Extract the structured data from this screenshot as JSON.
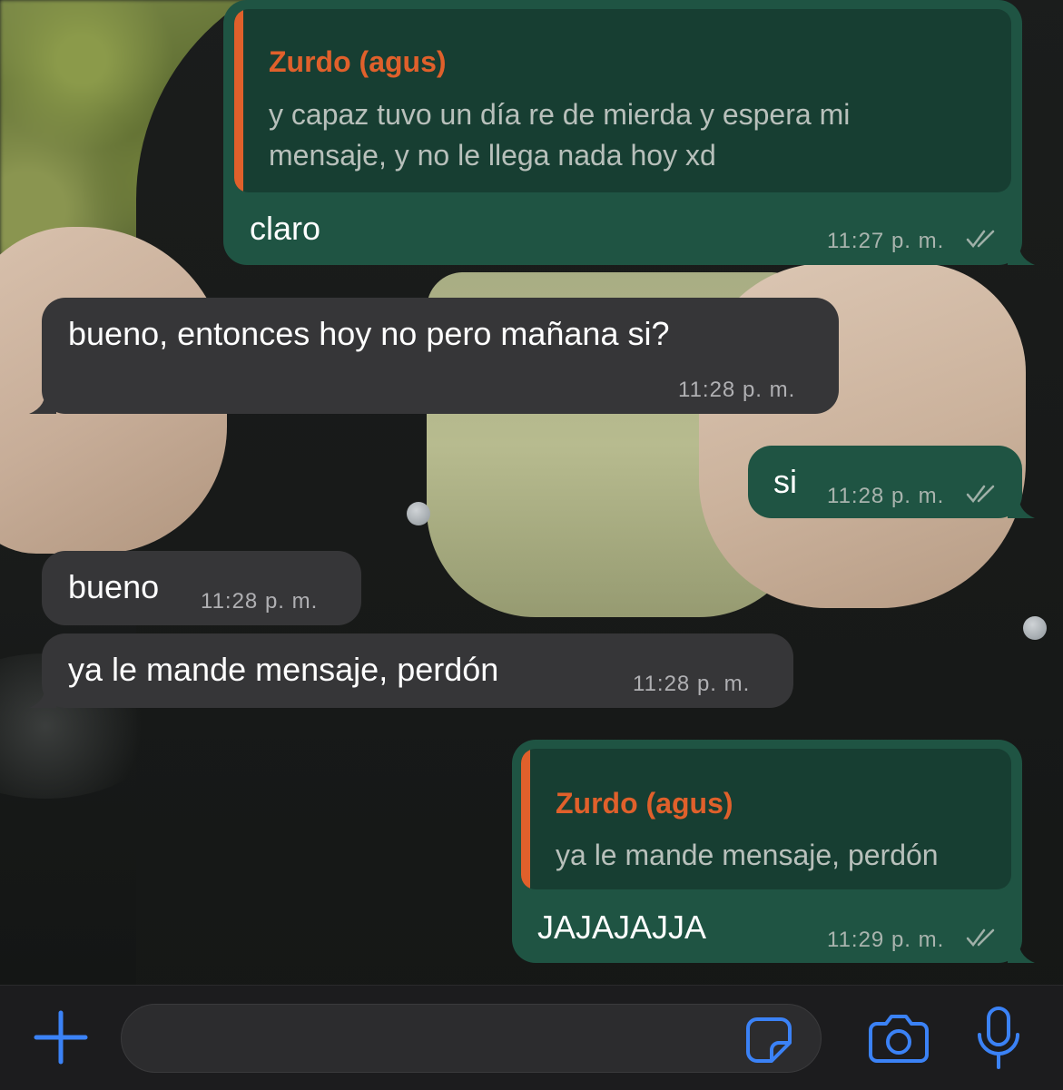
{
  "app": {
    "accent_color": "#3b82f6",
    "outgoing_bubble_color": "#1f5443",
    "incoming_bubble_color": "#363638",
    "quote_author_color": "#e0602b"
  },
  "messages": [
    {
      "direction": "outgoing",
      "quote": {
        "author": "Zurdo (agus)",
        "line1": "y capaz tuvo un día re de mierda y espera mi",
        "line2": "mensaje, y no le llega nada hoy xd"
      },
      "text": "claro",
      "time": "11:27 p. m.",
      "status": "read-ticks-icon"
    },
    {
      "direction": "incoming",
      "text": "bueno, entonces hoy no pero mañana si?",
      "time": "11:28 p. m."
    },
    {
      "direction": "outgoing",
      "text": "si",
      "time": "11:28 p. m.",
      "status": "read-ticks-icon"
    },
    {
      "direction": "incoming",
      "text": "bueno",
      "time": "11:28 p. m."
    },
    {
      "direction": "incoming",
      "text": "ya le mande mensaje, perdón",
      "time": "11:28 p. m."
    },
    {
      "direction": "outgoing",
      "quote": {
        "author": "Zurdo (agus)",
        "line1": "ya le mande mensaje, perdón"
      },
      "text": "JAJAJAJJA",
      "time": "11:29 p. m.",
      "status": "read-ticks-icon"
    }
  ],
  "input_bar": {
    "add_icon": "plus-icon",
    "message_placeholder": "",
    "sticker_icon": "sticker-icon",
    "camera_icon": "camera-icon",
    "mic_icon": "microphone-icon"
  }
}
